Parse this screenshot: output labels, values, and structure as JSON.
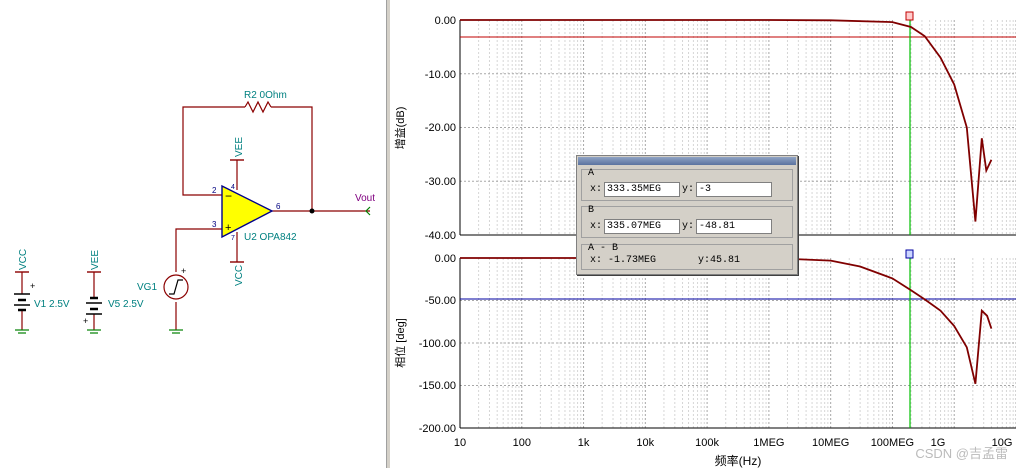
{
  "schematic": {
    "r2_label": "R2 0Ohm",
    "u2_label": "U2 OPA842",
    "vg1_label": "VG1",
    "v1_label": "V1 2.5V",
    "v5_label": "V5 2.5V",
    "vout_label": "Vout",
    "vcc_label": "VCC",
    "vee_label": "VEE",
    "pins": {
      "p2": "2",
      "p3": "3",
      "p6": "6",
      "p4": "4",
      "p7": "7"
    }
  },
  "gain_plot": {
    "ylabel": "增益(dB)",
    "yticks": [
      "0.00",
      "-10.00",
      "-20.00",
      "-30.00",
      "-40.00"
    ],
    "ylim": [
      -40,
      0
    ],
    "cursor_level": -3
  },
  "phase_plot": {
    "ylabel": "相位 [deg]",
    "yticks": [
      "0.00",
      "-50.00",
      "-100.00",
      "-150.00",
      "-200.00"
    ],
    "ylim": [
      -200,
      0
    ],
    "cursor_level": -50
  },
  "x_axis": {
    "label": "频率(Hz)",
    "ticks": [
      "10",
      "100",
      "1k",
      "10k",
      "100k",
      "1MEG",
      "10MEG",
      "100MEG",
      "1G",
      "10G"
    ],
    "scale": "log",
    "range": [
      10,
      10000000000
    ]
  },
  "chart_data": {
    "type": "line",
    "x_scale": "log",
    "series": [
      {
        "panel": "gain",
        "x": [
          10,
          1000000,
          10000000,
          100000000,
          200000000,
          333350000,
          600000000,
          1000000000,
          1600000000,
          2200000000,
          2800000000,
          3300000000,
          4000000000
        ],
        "values": [
          0,
          0,
          -0.05,
          -0.4,
          -1.3,
          -3,
          -7,
          -12,
          -20,
          -37.5,
          -22,
          -28,
          -26
        ]
      },
      {
        "panel": "phase",
        "x": [
          10,
          1000000,
          10000000,
          30000000,
          100000000,
          200000000,
          335070000,
          600000000,
          1000000000,
          1600000000,
          2200000000,
          2800000000,
          3400000000,
          4000000000
        ],
        "values": [
          0,
          0,
          -3,
          -10,
          -24,
          -38,
          -48.81,
          -62,
          -80,
          -105,
          -148,
          -62,
          -68,
          -83
        ]
      }
    ],
    "cursor_x": 333350000
  },
  "cursor_panel": {
    "a_header": "A",
    "a_x_label": "x:",
    "a_x": "333.35MEG",
    "a_y_label": "y:",
    "a_y": "-3",
    "b_header": "B",
    "b_x_label": "x:",
    "b_x": "335.07MEG",
    "b_y_label": "y:",
    "b_y": "-48.81",
    "diff_header": "A - B",
    "diff_x": "x: -1.73MEG",
    "diff_y": "y:45.81"
  },
  "watermark": "CSDN @吉孟雷",
  "colors": {
    "trace": "#800000",
    "grid": "#b0b0b0",
    "cursor_line": "#00c000",
    "gain_ref": "#c00000",
    "phase_ref": "#0000a0",
    "wire": "#8b0000",
    "label": "#008080",
    "opamp_fill": "#ffff00"
  }
}
